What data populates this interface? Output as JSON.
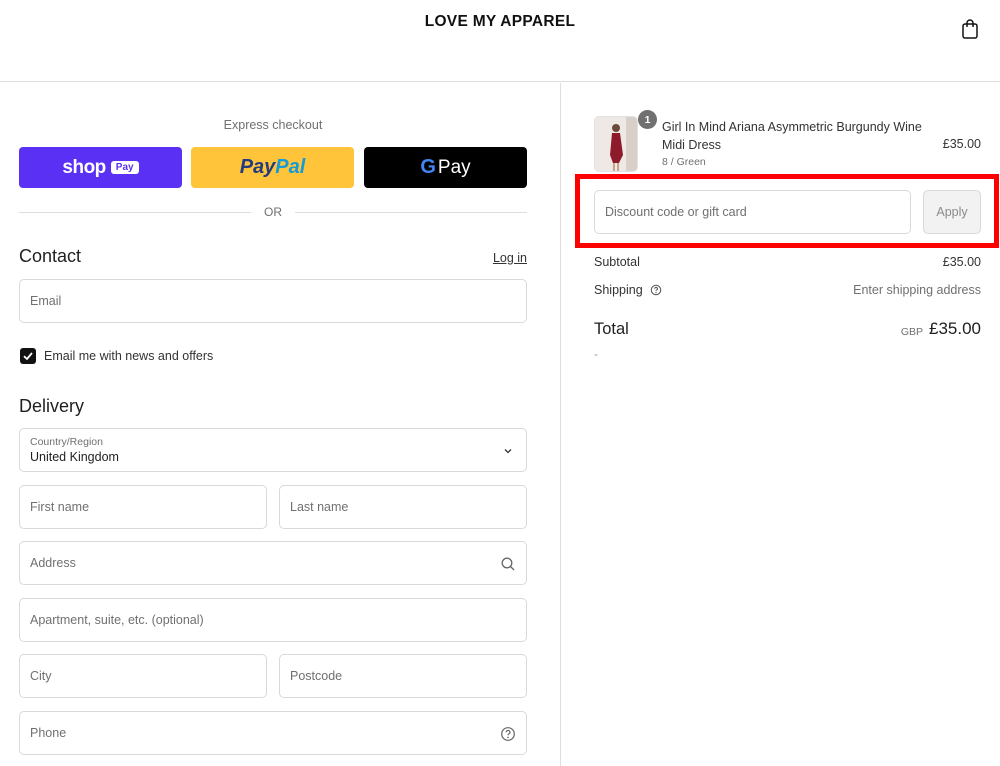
{
  "header": {
    "brand": "LOVE MY APPAREL",
    "cart_icon": "shopping-bag-icon"
  },
  "express": {
    "title": "Express checkout",
    "shop_pay": {
      "word": "shop",
      "badge": "Pay"
    },
    "paypal": {
      "part1": "Pay",
      "part2": "Pal"
    },
    "gpay": {
      "g": "G",
      "word": "Pay"
    },
    "or_text": "OR"
  },
  "contact": {
    "title": "Contact",
    "login_label": "Log in",
    "email_placeholder": "Email",
    "newsletter_label": "Email me with news and offers",
    "newsletter_checked": true
  },
  "delivery": {
    "title": "Delivery",
    "country_label": "Country/Region",
    "country_value": "United Kingdom",
    "first_name_placeholder": "First name",
    "last_name_placeholder": "Last name",
    "address_placeholder": "Address",
    "apartment_placeholder": "Apartment, suite, etc. (optional)",
    "city_placeholder": "City",
    "postcode_placeholder": "Postcode",
    "phone_placeholder": "Phone"
  },
  "summary": {
    "item": {
      "quantity": "1",
      "name": "Girl In Mind Ariana Asymmetric Burgundy Wine Midi Dress",
      "variant": "8 / Green",
      "price": "£35.00"
    },
    "discount_placeholder": "Discount code or gift card",
    "apply_label": "Apply",
    "subtotal_label": "Subtotal",
    "subtotal_value": "£35.00",
    "shipping_label": "Shipping",
    "shipping_value": "Enter shipping address",
    "total_label": "Total",
    "total_currency": "GBP",
    "total_value": "£35.00",
    "dash": "-"
  },
  "colors": {
    "shop_pay": "#5a31f4",
    "paypal": "#ffc439",
    "gpay": "#000000",
    "highlight": "#ff0000"
  }
}
